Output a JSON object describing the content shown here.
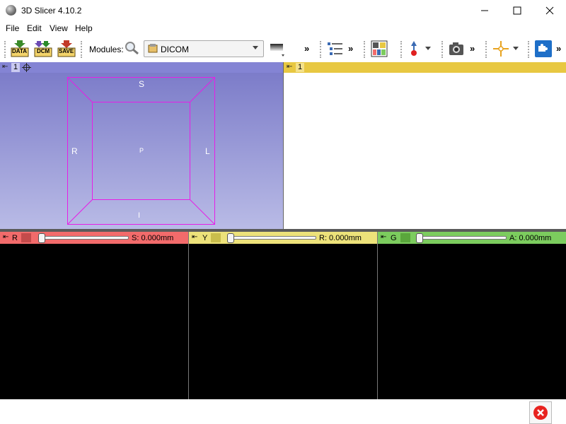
{
  "window": {
    "title": "3D Slicer 4.10.2"
  },
  "menu": {
    "items": [
      {
        "label": "File"
      },
      {
        "label": "Edit"
      },
      {
        "label": "View"
      },
      {
        "label": "Help"
      }
    ]
  },
  "toolbar": {
    "data_label": "DATA",
    "dcm_label": "DCM",
    "save_label": "SAVE",
    "modules_label": "Modules:",
    "module_selected": "DICOM",
    "chevron": "»"
  },
  "view3d": {
    "id_label": "1",
    "orientation": {
      "superior": "S",
      "inferior": "I",
      "right": "R",
      "left": "L",
      "posterior": "P"
    }
  },
  "chart_view": {
    "id_label": "1"
  },
  "slices": [
    {
      "name": "R",
      "offset": "S: 0.000mm",
      "color": "#f26b6b"
    },
    {
      "name": "Y",
      "offset": "R: 0.000mm",
      "color": "#ede27a"
    },
    {
      "name": "G",
      "offset": "A: 0.000mm",
      "color": "#7ccc5e"
    }
  ],
  "colors": {
    "view3d_header": "#8484d4",
    "chart_header": "#e8c842",
    "box": "#e61ee6",
    "error": "#e8231f"
  }
}
